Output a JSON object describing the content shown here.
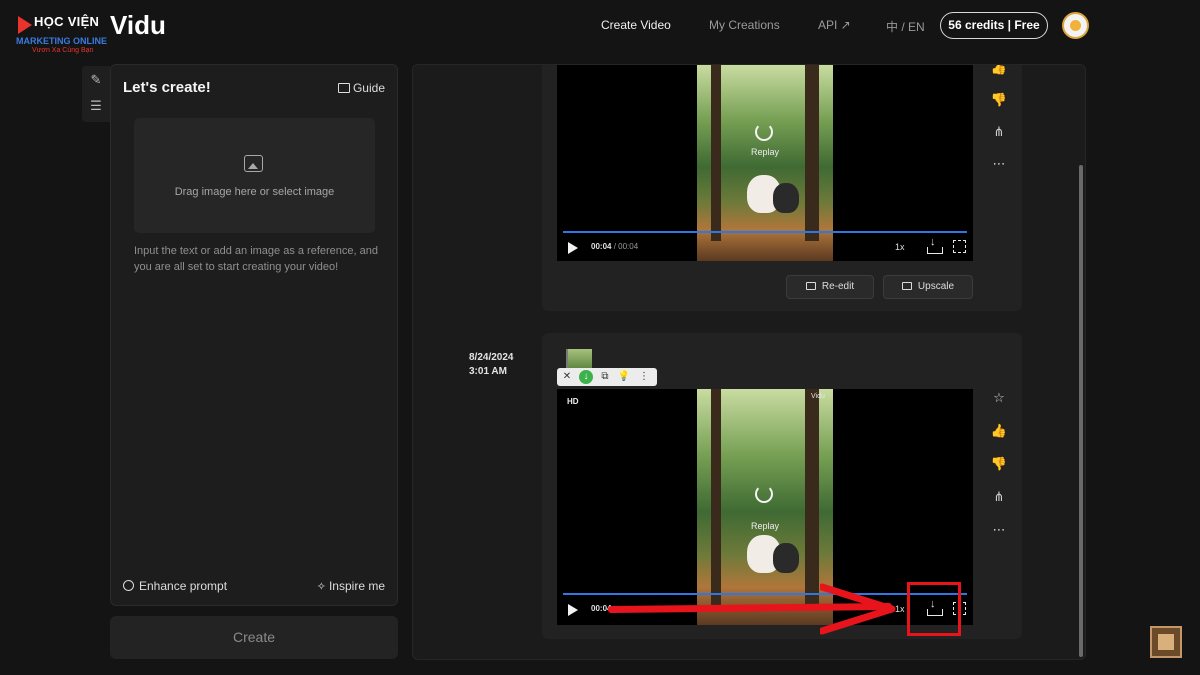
{
  "logo": {
    "main": "HỌC VIỆN",
    "sub": "MARKETING ONLINE",
    "tagline": "Vươn Xa Cùng Bạn"
  },
  "header": {
    "brand": "Vidu",
    "nav": {
      "create_video": "Create Video",
      "my_creations": "My Creations",
      "api": "API ↗",
      "language": "中 / EN"
    },
    "credits": "56 credits | Free"
  },
  "left_panel": {
    "title": "Let's create!",
    "guide_label": "Guide",
    "dropzone_text": "Drag image here or select image",
    "hint": "Input the text or add an image as a reference, and you are all set to start creating your video!",
    "enhance_label": "Enhance prompt",
    "inspire_label": "Inspire me",
    "create_label": "Create"
  },
  "video1": {
    "replay": "Replay",
    "time_current": "00:04",
    "time_total": "00:04",
    "speed": "1x",
    "progress": 1.0,
    "reedit_label": "Re-edit",
    "upscale_label": "Upscale"
  },
  "video2": {
    "date": "8/24/2024",
    "time_of_day": "3:01 AM",
    "quality": "HD",
    "watermark": "Vidu",
    "replay": "Replay",
    "time_current": "00:04",
    "speed": "1x",
    "progress": 1.0
  },
  "colors": {
    "accent_progress": "#2f78e4",
    "annotation": "#e8141c",
    "background": "#141414"
  }
}
